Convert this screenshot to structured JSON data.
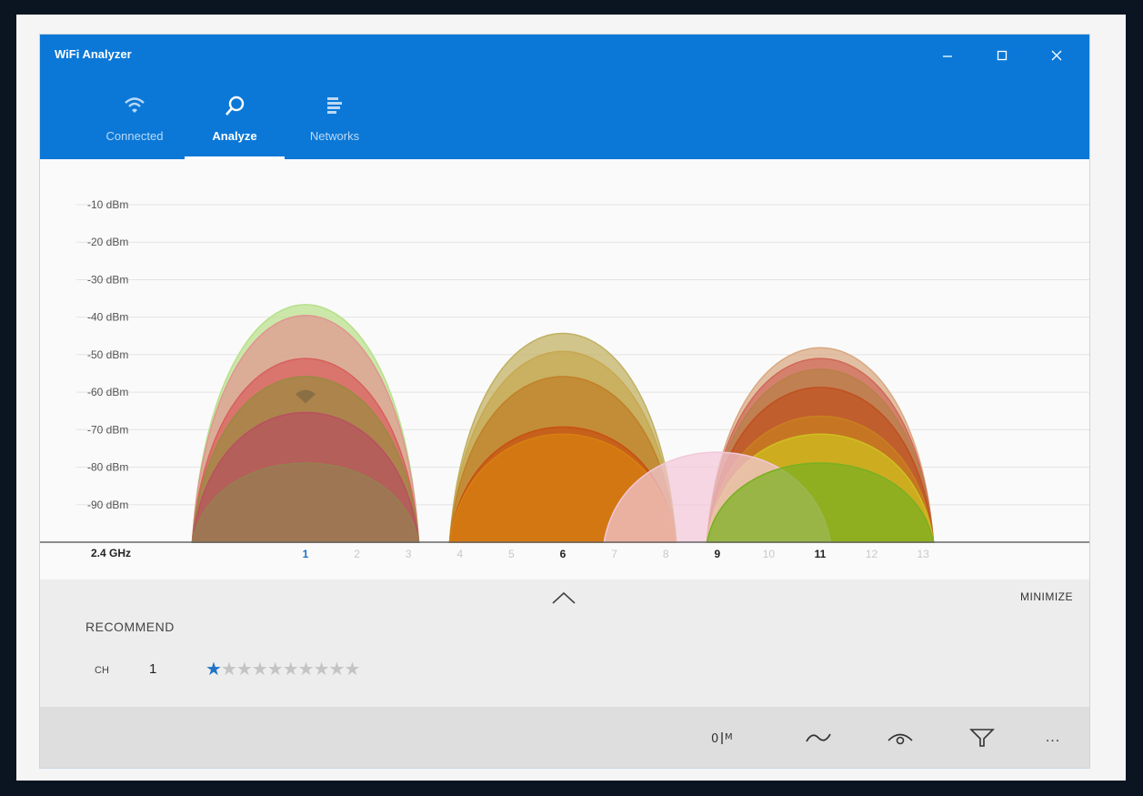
{
  "app_title": "WiFi Analyzer",
  "window_controls": [
    "minimize",
    "maximize",
    "close"
  ],
  "tabs": [
    {
      "label": "Connected",
      "icon": "wifi-icon",
      "active": false
    },
    {
      "label": "Analyze",
      "icon": "search-icon",
      "active": true
    },
    {
      "label": "Networks",
      "icon": "list-icon",
      "active": false
    }
  ],
  "chart_data": {
    "type": "area",
    "band_label": "2.4 GHz",
    "y_labels": [
      "-10 dBm",
      "-20 dBm",
      "-30 dBm",
      "-40 dBm",
      "-50 dBm",
      "-60 dBm",
      "-70 dBm",
      "-80 dBm",
      "-90 dBm"
    ],
    "ylim": [
      -100,
      0
    ],
    "channels": [
      "1",
      "2",
      "3",
      "4",
      "5",
      "6",
      "7",
      "8",
      "9",
      "10",
      "11",
      "12",
      "13"
    ],
    "emphasized_channels": [
      "1",
      "6",
      "9",
      "11"
    ],
    "selected_channel": "1",
    "grid": true,
    "networks": [
      {
        "channel": 1,
        "dbm": -34,
        "color": "#b8e08a"
      },
      {
        "channel": 1,
        "dbm": -37,
        "color": "#e09590"
      },
      {
        "channel": 1,
        "dbm": -49,
        "color": "#d8605c"
      },
      {
        "channel": 1,
        "dbm": -54,
        "color": "#9a8a40"
      },
      {
        "channel": 1,
        "dbm": -64,
        "color": "#b85060"
      },
      {
        "channel": 1,
        "dbm": -78,
        "color": "#958050"
      },
      {
        "channel": 6,
        "dbm": -42,
        "color": "#c0b060"
      },
      {
        "channel": 6,
        "dbm": -47,
        "color": "#c8a850"
      },
      {
        "channel": 6,
        "dbm": -54,
        "color": "#c08028"
      },
      {
        "channel": 6,
        "dbm": -68,
        "color": "#c85010"
      },
      {
        "channel": 6,
        "dbm": -70,
        "color": "#d88010"
      },
      {
        "channel": 9,
        "dbm": -75,
        "color": "#f2c8d8"
      },
      {
        "channel": 11,
        "dbm": -46,
        "color": "#d8a880"
      },
      {
        "channel": 11,
        "dbm": -49,
        "color": "#d06858"
      },
      {
        "channel": 11,
        "dbm": -52,
        "color": "#b88048"
      },
      {
        "channel": 11,
        "dbm": -57,
        "color": "#c05020"
      },
      {
        "channel": 11,
        "dbm": -65,
        "color": "#c88020"
      },
      {
        "channel": 11,
        "dbm": -70,
        "color": "#d0c020"
      },
      {
        "channel": 11,
        "dbm": -78,
        "color": "#78b020"
      }
    ],
    "connected_channel": 1,
    "connected_dbm": -61
  },
  "panel": {
    "minimize_label": "MINIMIZE",
    "recommend_label": "RECOMMEND",
    "ch_label": "CH",
    "ch_value": "1",
    "rating": 1,
    "rating_max": 10
  },
  "toolbar": {
    "icons": [
      "antenna-icon",
      "wave-icon",
      "eye-icon",
      "filter-icon",
      "more-icon"
    ],
    "more_label": "..."
  },
  "colors": {
    "accent": "#0b78d7",
    "star_active": "#1f74c8"
  }
}
